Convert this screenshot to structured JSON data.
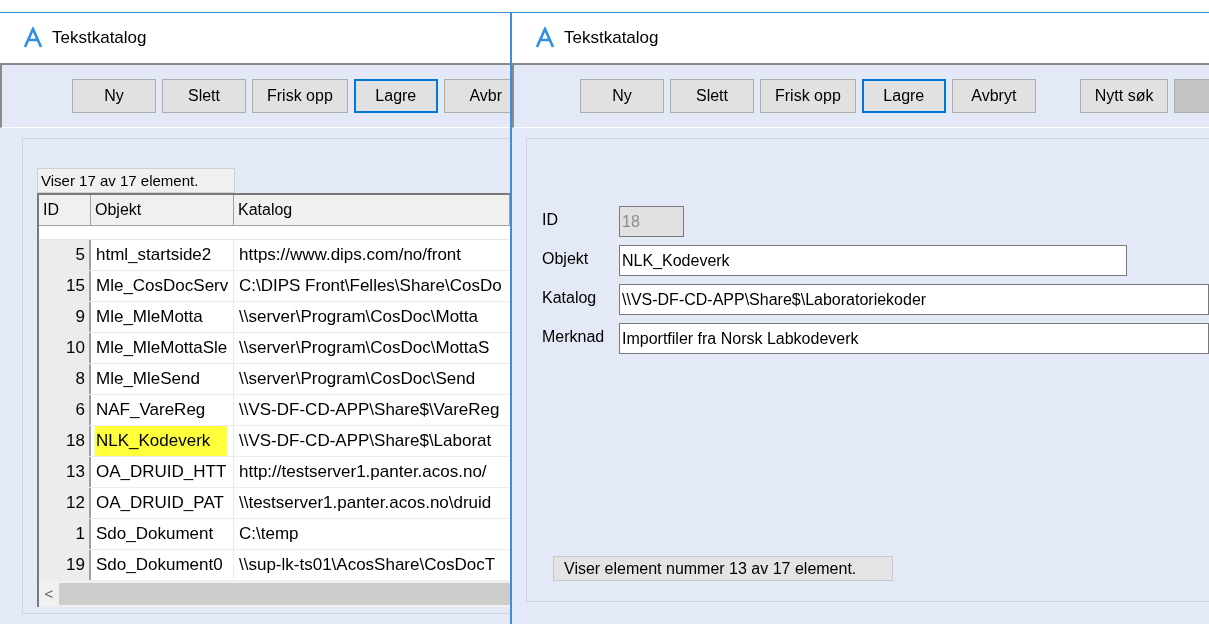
{
  "list_window": {
    "title": "Tekstkatalog",
    "toolbar": [
      {
        "label": "Ny",
        "focused": false,
        "disabled": false
      },
      {
        "label": "Slett",
        "focused": false,
        "disabled": false
      },
      {
        "label": "Frisk opp",
        "focused": false,
        "disabled": false
      },
      {
        "label": "Lagre",
        "focused": true,
        "disabled": false
      },
      {
        "label": "Avbr",
        "focused": false,
        "disabled": false
      }
    ],
    "count_label": "Viser 17 av 17 element.",
    "table": {
      "columns": [
        "ID",
        "Objekt",
        "Katalog"
      ],
      "rows": [
        {
          "id": "5",
          "objekt": "html_startside2",
          "katalog": "https://www.dips.com/no/front",
          "highlighted": false
        },
        {
          "id": "15",
          "objekt": "Mle_CosDocServ",
          "katalog": "C:\\DIPS Front\\Felles\\Share\\CosDo",
          "highlighted": false
        },
        {
          "id": "9",
          "objekt": "Mle_MleMotta",
          "katalog": "\\\\server\\Program\\CosDoc\\Motta",
          "highlighted": false
        },
        {
          "id": "10",
          "objekt": "Mle_MleMottaSle",
          "katalog": "\\\\server\\Program\\CosDoc\\MottaS",
          "highlighted": false
        },
        {
          "id": "8",
          "objekt": "Mle_MleSend",
          "katalog": "\\\\server\\Program\\CosDoc\\Send",
          "highlighted": false
        },
        {
          "id": "6",
          "objekt": "NAF_VareReg",
          "katalog": "\\\\VS-DF-CD-APP\\Share$\\VareReg",
          "highlighted": false
        },
        {
          "id": "18",
          "objekt": "NLK_Kodeverk",
          "katalog": "\\\\VS-DF-CD-APP\\Share$\\Laborat",
          "highlighted": true
        },
        {
          "id": "13",
          "objekt": "OA_DRUID_HTT",
          "katalog": "http://testserver1.panter.acos.no/",
          "highlighted": false
        },
        {
          "id": "12",
          "objekt": "OA_DRUID_PAT",
          "katalog": "\\\\testserver1.panter.acos.no\\druid",
          "highlighted": false
        },
        {
          "id": "1",
          "objekt": "Sdo_Dokument",
          "katalog": "C:\\temp",
          "highlighted": false
        },
        {
          "id": "19",
          "objekt": "Sdo_Dokument0",
          "katalog": "\\\\sup-lk-ts01\\AcosShare\\CosDocT",
          "highlighted": false
        }
      ]
    },
    "scroll_left": "<"
  },
  "detail_window": {
    "title": "Tekstkatalog",
    "toolbar": [
      {
        "label": "Ny",
        "focused": false,
        "disabled": false
      },
      {
        "label": "Slett",
        "focused": false,
        "disabled": false
      },
      {
        "label": "Frisk opp",
        "focused": false,
        "disabled": false
      },
      {
        "label": "Lagre",
        "focused": true,
        "disabled": false
      },
      {
        "label": "Avbryt",
        "focused": false,
        "disabled": false
      }
    ],
    "search_toolbar": [
      {
        "label": "Nytt søk",
        "focused": false,
        "disabled": false
      },
      {
        "focused": false,
        "disabled": true
      }
    ],
    "fields": [
      {
        "label": "ID",
        "value": "18",
        "disabled": true
      },
      {
        "label": "Objekt",
        "value": "NLK_Kodeverk",
        "disabled": false
      },
      {
        "label": "Katalog",
        "value": "\\\\VS-DF-CD-APP\\Share$\\Laboratoriekoder",
        "disabled": false
      },
      {
        "label": "Merknad",
        "value": "Importfiler fra Norsk Labkodeverk",
        "disabled": false
      }
    ],
    "status": "Viser element nummer 13 av 17 element."
  }
}
